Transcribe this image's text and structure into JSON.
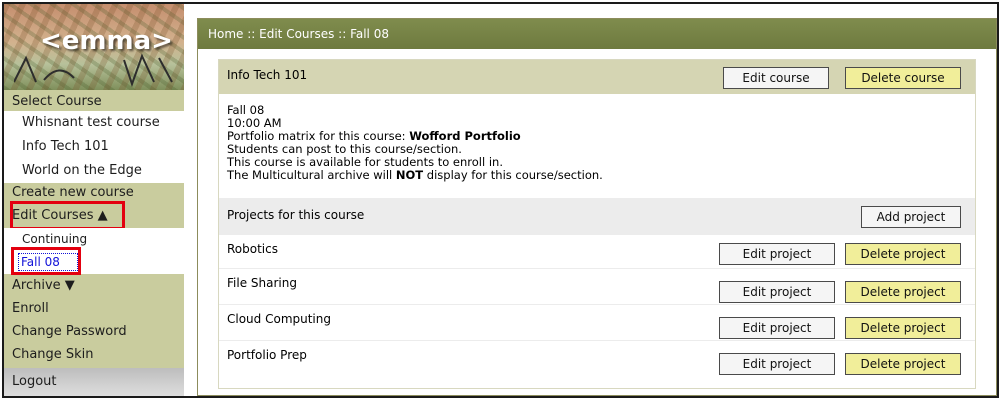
{
  "sidebar": {
    "logo_text": "<emma>",
    "select_course_label": "Select Course",
    "courses": [
      "Whisnant test course",
      "Info Tech 101",
      "World on the Edge"
    ],
    "create_label": "Create new course",
    "edit_courses_label": "Edit Courses ▲",
    "edit_sub": {
      "continuing": "Continuing",
      "fall": "Fall 08"
    },
    "archive_label": "Archive ▼",
    "enroll_label": "Enroll",
    "change_password_label": "Change Password",
    "change_skin_label": "Change Skin",
    "logout_label": "Logout"
  },
  "breadcrumb": "Home :: Edit Courses :: Fall 08",
  "course": {
    "title": "Info Tech 101",
    "edit_label": "Edit course",
    "delete_label": "Delete course",
    "section": "Fall 08",
    "time": "10:00 AM",
    "portfolio_prefix": "Portfolio matrix for this course: ",
    "portfolio_name": "Wofford Portfolio",
    "line_post": "Students can post to this course/section.",
    "line_enroll": "This course is available for students to enroll in.",
    "archive_prefix": "The Multicultural archive will ",
    "archive_not": "NOT",
    "archive_suffix": " display for this course/section."
  },
  "projects": {
    "header": "Projects for this course",
    "add_label": "Add project",
    "edit_label": "Edit project",
    "delete_label": "Delete project",
    "items": [
      "Robotics",
      "File Sharing",
      "Cloud Computing",
      "Portfolio Prep"
    ]
  },
  "colors": {
    "sidebar_bg": "#c9cc9e",
    "header_olive": "#7f8c4d",
    "highlight_red": "#e3000f",
    "delete_yellow": "#f1ee9a"
  }
}
